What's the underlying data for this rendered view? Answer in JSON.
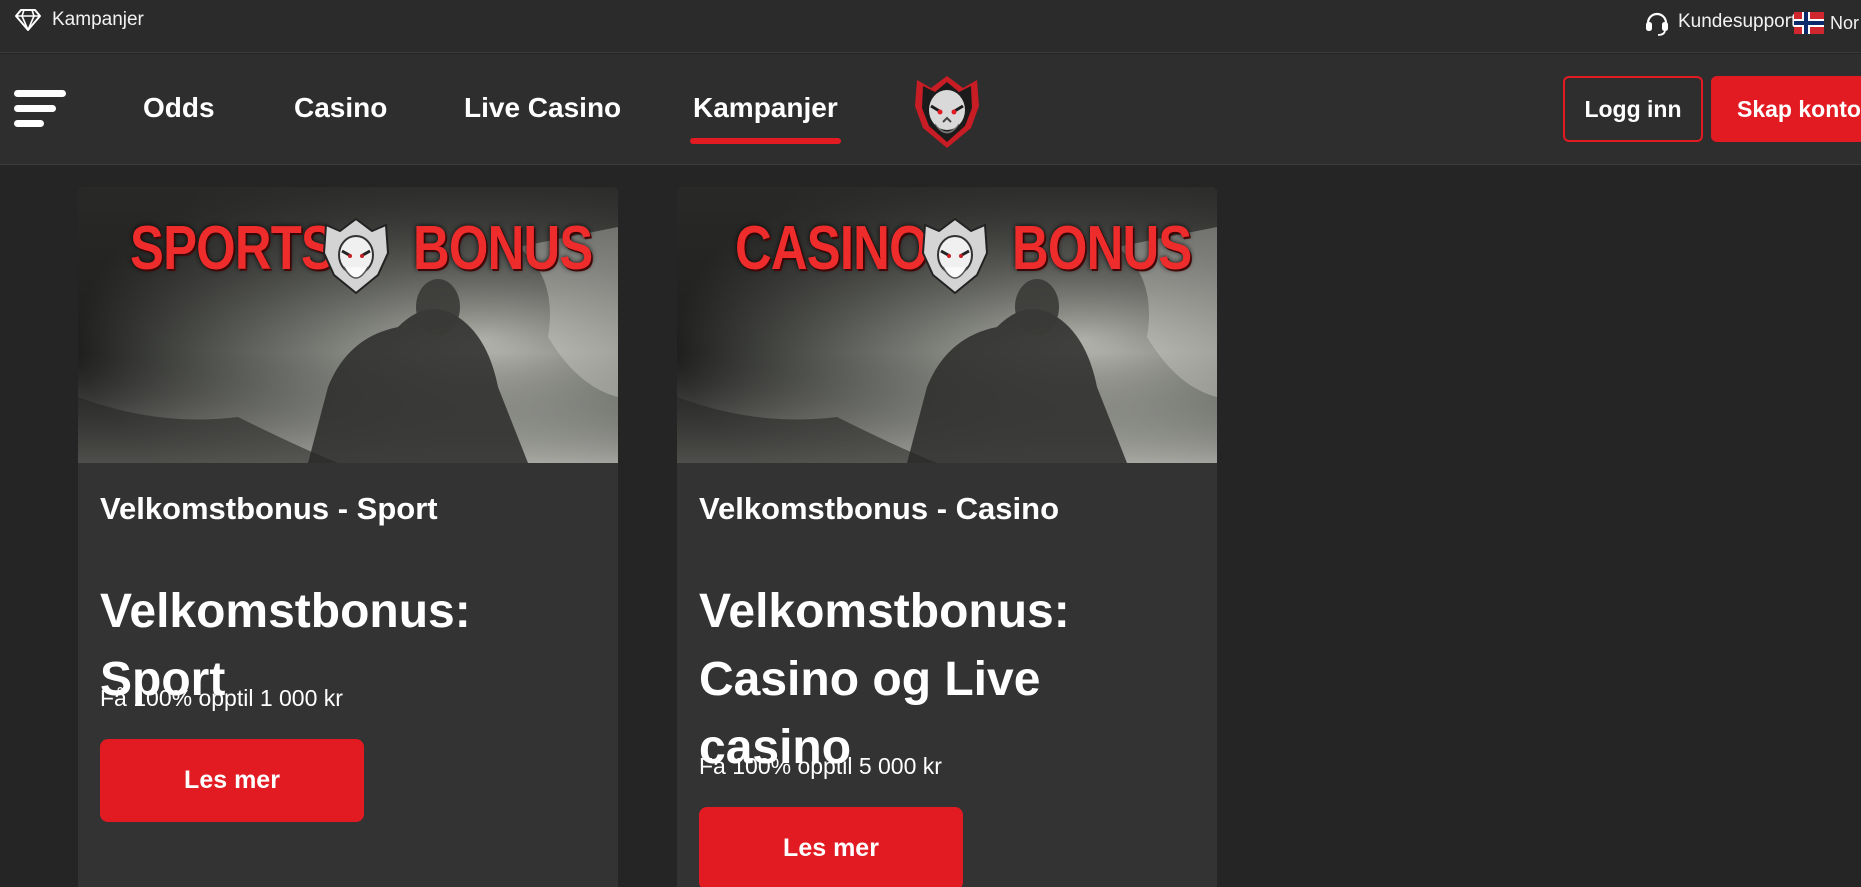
{
  "topbar": {
    "promo_label": "Kampanjer",
    "promo_icon": "diamond-icon",
    "support_label": "Kundesupport",
    "support_icon": "headset-icon",
    "language_label": "Nor",
    "language_icon": "norway-flag-icon"
  },
  "nav": {
    "menu_icon": "hamburger-menu-icon",
    "links": [
      {
        "label": "Odds",
        "active": false
      },
      {
        "label": "Casino",
        "active": false
      },
      {
        "label": "Live Casino",
        "active": false
      },
      {
        "label": "Kampanjer",
        "active": true
      }
    ],
    "logo_icon": "viking-logo-icon",
    "login_label": "Logg inn",
    "signup_label": "Skap konto"
  },
  "cards": [
    {
      "banner_left": "SPORTS",
      "banner_right": "BONUS",
      "subtitle": "Velkomstbonus - Sport",
      "headline": "Velkomstbonus: Sport",
      "description": "Få 100% opptil 1 000 kr",
      "cta_label": "Les mer"
    },
    {
      "banner_left": "CASINO",
      "banner_right": "BONUS",
      "subtitle": "Velkomstbonus - Casino",
      "headline": "Velkomstbonus: Casino og Live casino",
      "description": "Få 100% opptil 5 000 kr",
      "cta_label": "Les mer"
    }
  ],
  "colors": {
    "accent": "#e21b23",
    "background": "#252525",
    "card": "#333333",
    "nav": "#2e2e2e"
  }
}
